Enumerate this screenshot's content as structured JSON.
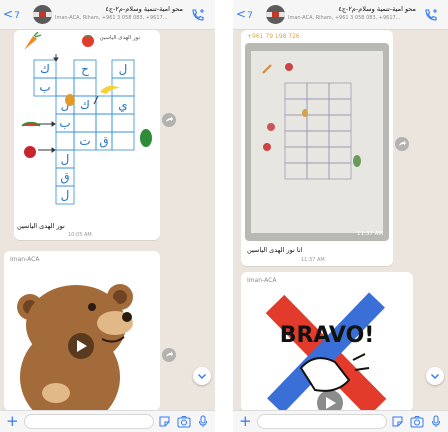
{
  "panels": [
    {
      "header": {
        "back_label": "<",
        "unread_count": "7",
        "group_title": "محو امية-تنمية وسلام-م٢-ج٤",
        "members": "Iman-ACA, Riham, +961 3 058 083, +9617..."
      },
      "messages": {
        "image_caption": "نور الهدى الياسين",
        "image_time": "10:05 AM",
        "caption_time": "10:05 AM",
        "video_sender": "Iman-ACA"
      },
      "composer": {
        "placeholder": ""
      }
    },
    {
      "header": {
        "back_label": "<",
        "unread_count": "7",
        "group_title": "محو امية-تنمية وسلام-م٢-ج٤",
        "members": "Iman-ACA, Riham, +961 3 058 083, +9617..."
      },
      "messages": {
        "phone": "+961 79 198 726",
        "image_caption": "انا نور الهدى الياسين",
        "image_time": "11:37 AM",
        "caption_time": "11:37 AM",
        "video_sender": "Iman-ACA"
      },
      "composer": {
        "placeholder": ""
      }
    }
  ],
  "worksheet": {
    "header_text": "نور الهدى الياسين",
    "letters": [
      "ك",
      "ح",
      "ل",
      "ب",
      "ي",
      "ك",
      "ل",
      "ب",
      "ت",
      "ق",
      "ل",
      "ق",
      "ل"
    ]
  },
  "sticker": {
    "line1": "BRAVO!",
    "line2": "BRAVO!"
  },
  "icons": {
    "back": "chevron-left-icon",
    "call": "add-call-icon",
    "forward": "share-icon",
    "play": "play-icon",
    "scroll": "chevron-down-icon",
    "attach": "plus-icon",
    "sticker": "sticker-icon",
    "camera": "camera-icon",
    "mic": "microphone-icon"
  },
  "colors": {
    "accent": "#3478f6",
    "chat_background": "#ece5dd",
    "phone_color": "#e2a53b",
    "bubble": "#ffffff"
  }
}
